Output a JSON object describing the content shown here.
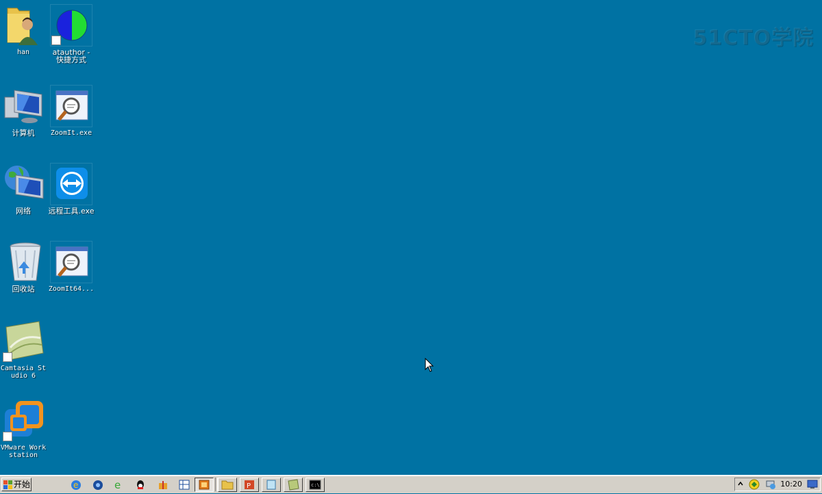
{
  "watermark": "51CTO学院",
  "desktop_icons": [
    {
      "label": "han"
    },
    {
      "label": "atauthor - 快捷方式"
    },
    {
      "label": "计算机"
    },
    {
      "label": "ZoomIt.exe"
    },
    {
      "label": "网络"
    },
    {
      "label": "远程工具.exe"
    },
    {
      "label": "回收站"
    },
    {
      "label": "ZoomIt64..."
    },
    {
      "label": "Camtasia Studio 6"
    },
    {
      "label": "VMware Workstation"
    }
  ],
  "taskbar": {
    "start_label": "开始",
    "clock": "10:20",
    "quicklaunch": [
      "ie-icon",
      "media-icon",
      "ie2-icon",
      "qq-icon",
      "gift-icon",
      "grid-icon"
    ],
    "tasks": [
      "app-task-1",
      "app-task-2",
      "explorer-task",
      "powerpoint-task",
      "notepad-task",
      "camtasia-task",
      "cmd-task"
    ]
  }
}
